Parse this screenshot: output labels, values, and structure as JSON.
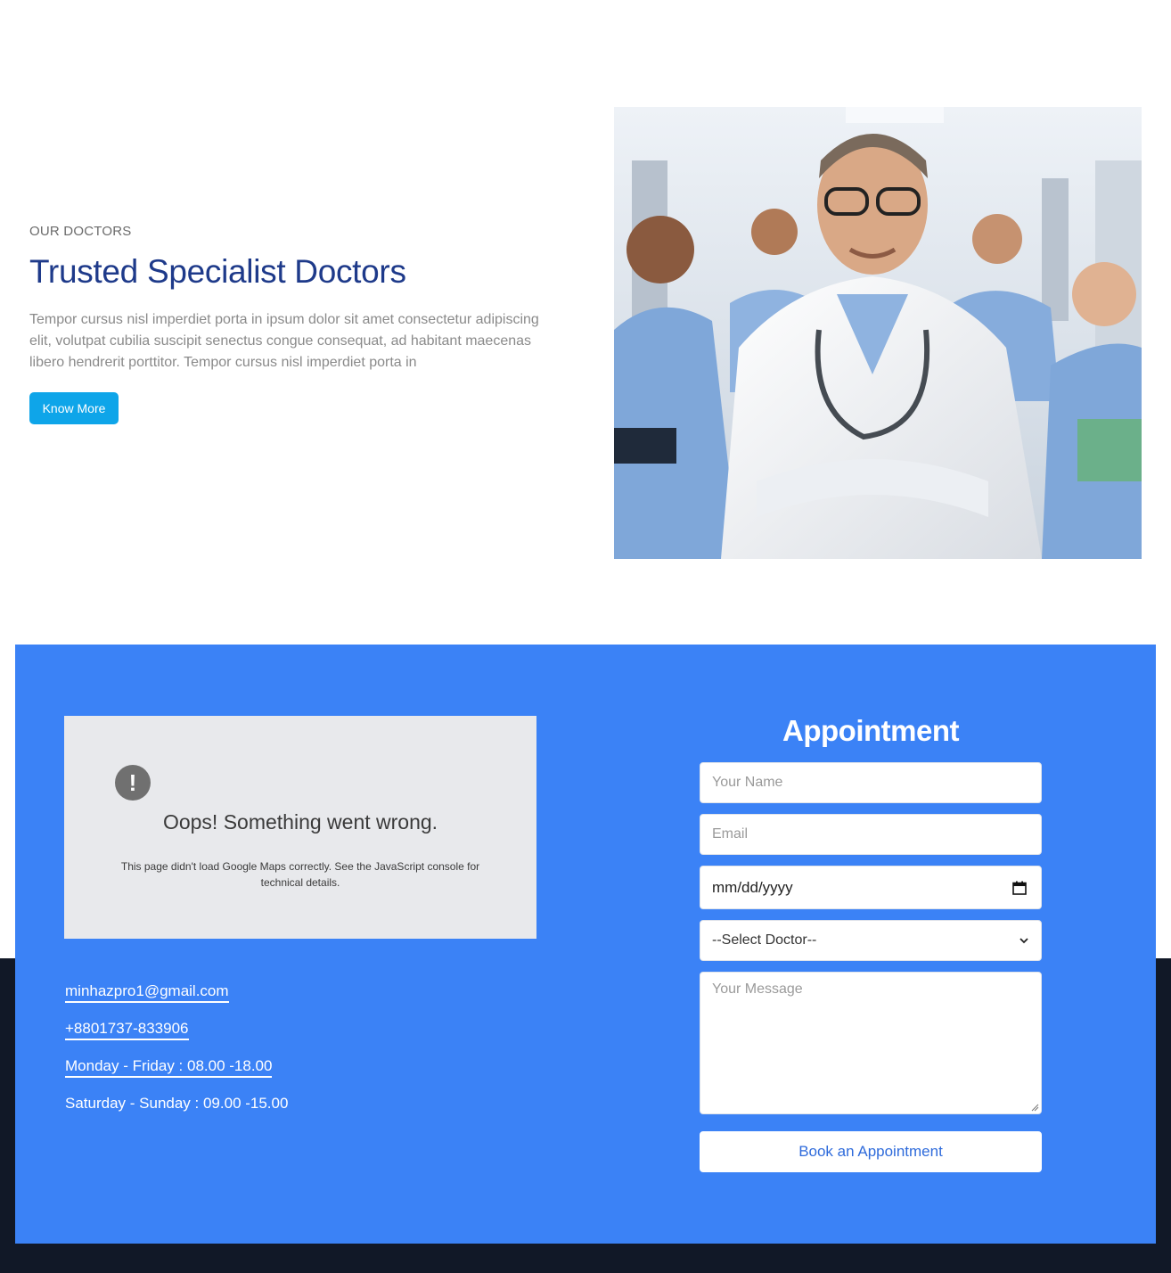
{
  "about": {
    "kicker": "OUR DOCTORS",
    "headline": "Trusted Specialist Doctors",
    "body": "Tempor cursus nisl imperdiet porta in ipsum dolor sit amet consectetur adipiscing elit, volutpat cubilia suscipit senectus congue consequat, ad habitant maecenas libero hendrerit porttitor. Tempor cursus nisl imperdiet porta in",
    "button_label": "Know More"
  },
  "map": {
    "alert_glyph": "!",
    "error_title": "Oops! Something went wrong.",
    "error_message": "This page didn't load Google Maps correctly. See the JavaScript console for technical details."
  },
  "contact": {
    "email": "minhazpro1@gmail.com",
    "phone": "+8801737-833906",
    "weekday_hours": "Monday - Friday : 08.00 -18.00",
    "weekend_hours": "Saturday - Sunday : 09.00 -15.00"
  },
  "appointment": {
    "title": "Appointment",
    "name_placeholder": "Your Name",
    "email_placeholder": "Email",
    "date_placeholder": "mm/dd/yyyy",
    "doctor_select_value": "--Select Doctor--",
    "message_placeholder": "Your Message",
    "submit_label": "Book an Appointment"
  },
  "colors": {
    "brand_blue": "#3b82f6",
    "headline_navy": "#1e3a8a",
    "cta_sky": "#0ea5e9",
    "footer_dark": "#111827"
  }
}
